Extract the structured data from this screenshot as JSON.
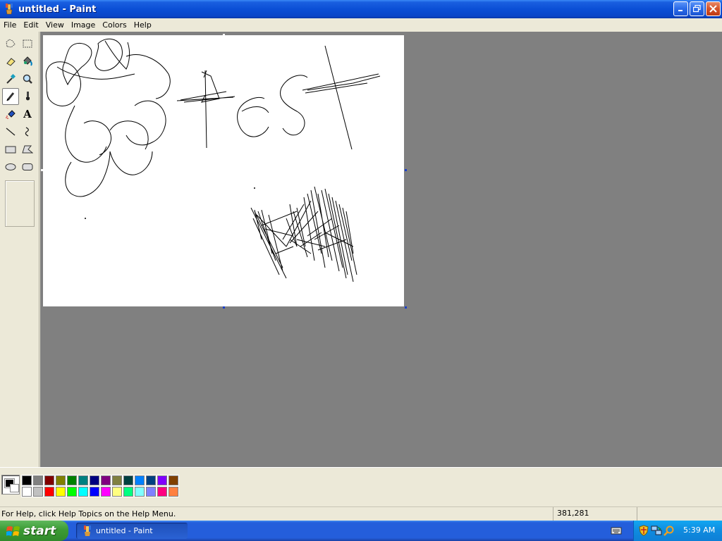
{
  "window": {
    "title": "untitled - Paint"
  },
  "menu": [
    "File",
    "Edit",
    "View",
    "Image",
    "Colors",
    "Help"
  ],
  "tools": [
    {
      "name": "free-form-select"
    },
    {
      "name": "select"
    },
    {
      "name": "eraser"
    },
    {
      "name": "fill-with-color"
    },
    {
      "name": "pick-color"
    },
    {
      "name": "magnifier"
    },
    {
      "name": "pencil"
    },
    {
      "name": "brush"
    },
    {
      "name": "airbrush"
    },
    {
      "name": "text",
      "glyph": "A"
    },
    {
      "name": "line"
    },
    {
      "name": "curve"
    },
    {
      "name": "rectangle"
    },
    {
      "name": "polygon"
    },
    {
      "name": "ellipse"
    },
    {
      "name": "rounded-rectangle"
    }
  ],
  "selected_tool": "pencil",
  "colors": {
    "foreground": "#000000",
    "background": "#ffffff",
    "workspace": "#808080",
    "palette_top": [
      "#000000",
      "#808080",
      "#800000",
      "#808000",
      "#008000",
      "#008080",
      "#000080",
      "#800080",
      "#808040",
      "#004040",
      "#0080ff",
      "#004080",
      "#8000ff",
      "#804000"
    ],
    "palette_bottom": [
      "#ffffff",
      "#c0c0c0",
      "#ff0000",
      "#ffff00",
      "#00ff00",
      "#00ffff",
      "#0000ff",
      "#ff00ff",
      "#ffff80",
      "#00ff80",
      "#80ffff",
      "#8080ff",
      "#ff0080",
      "#ff8040"
    ]
  },
  "status": {
    "help_text": "For Help, click Help Topics on the Help Menu.",
    "coordinates": "381,281"
  },
  "taskbar": {
    "start_label": "start",
    "task_label": "untitled - Paint",
    "clock": "5:39 AM"
  },
  "tray_icons": [
    "keyboard-icon",
    "security-shield-icon",
    "network-icon",
    "search-icon"
  ]
}
